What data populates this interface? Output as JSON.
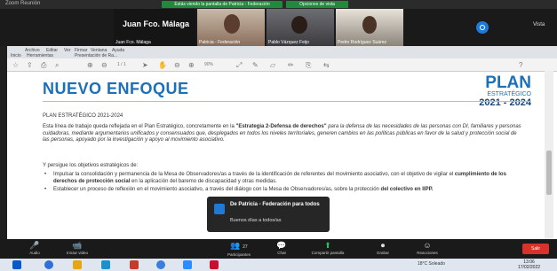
{
  "zoom": {
    "window_title": "Zoom Reunión",
    "banner": "Estás viendo la pantalla de Patricia - Federación",
    "view_options": "Opciones de vista"
  },
  "videos": {
    "main_name": "Juan Fco. Málaga",
    "tiles": [
      {
        "name": "Juan Fco. Málaga"
      },
      {
        "name": "Patricia - Federación"
      },
      {
        "name": "Pablo Vázquez Feijo"
      },
      {
        "name": "Pedro Rodríguez Suárez"
      }
    ],
    "view_label": "Vista"
  },
  "doc": {
    "menu": [
      "Archivo",
      "Editar",
      "Ver",
      "Firmar",
      "Ventana",
      "Ayuda"
    ],
    "tabs": [
      "Inicio",
      "Herramientas",
      "Presentación de Ra..."
    ],
    "page_indicator": "1 / 1",
    "zoom_level": "90%",
    "title": "NUEVO ENFOQUE",
    "plan_line1": "PLAN",
    "plan_line2": "ESTRATÉGICO",
    "plan_line3": "2021 - 2024",
    "subhead": "PLAN ESTRATÉGICO 2021-2024",
    "para1_a": "Esta línea de trabajo queda reflejada en el Plan Estratégico, concretamente en la ",
    "para1_b": "\"Estrategia 2-Defensa de derechos\"",
    "para1_c": " para la defensa de las necesidades de las personas con DI, familiares y personas cuidadoras, mediante argumentarios unificados y consensuados que, desplegados en todos los niveles territoriales, generen cambios en las políticas públicas en favor de la salud y protección social de las personas, apoyado por la investigación y apoyo al movimiento asociativo.",
    "para2": "Y persigue los objetivos estratégicos de:",
    "bullet1_a": "Impulsar la consolidación y permanencia de la Mesa de Observadores/as a través de la identificación de referentes del movimiento asociativo, con el objetivo de vigilar el ",
    "bullet1_b": "cumplimiento de los derechos de protección social",
    "bullet1_c": " en la aplicación del baremo de discapacidad y otras medidas.",
    "bullet2_a": "Establecer un proceso de reflexión en el movimiento asociativo, a través del diálogo con la Mesa de Observadores/as, sobre la protección ",
    "bullet2_b": "del colectivo en IIPP."
  },
  "toast": {
    "from": "De Patricia - Federación para todos",
    "message": "Buenos días a todos/as"
  },
  "controls": [
    {
      "label": "Audio",
      "glyph": "🎤"
    },
    {
      "label": "Iniciar video",
      "glyph": "📹"
    },
    {
      "label": "Participantes",
      "glyph": "👥"
    },
    {
      "label": "Chat",
      "glyph": "💬"
    },
    {
      "label": "Compartir pantalla",
      "glyph": "⬆"
    },
    {
      "label": "Grabar",
      "glyph": "⏺"
    },
    {
      "label": "Reacciones",
      "glyph": "☺"
    }
  ],
  "participants_count": "27",
  "end_label": "Salir",
  "taskbar": {
    "tray_text": "18°C Soleado",
    "time": "13:06",
    "date": "17/02/2022"
  },
  "colors": {
    "accent": "#1b70b8",
    "zoom_green": "#1f8a3b",
    "end_red": "#d9312b"
  }
}
